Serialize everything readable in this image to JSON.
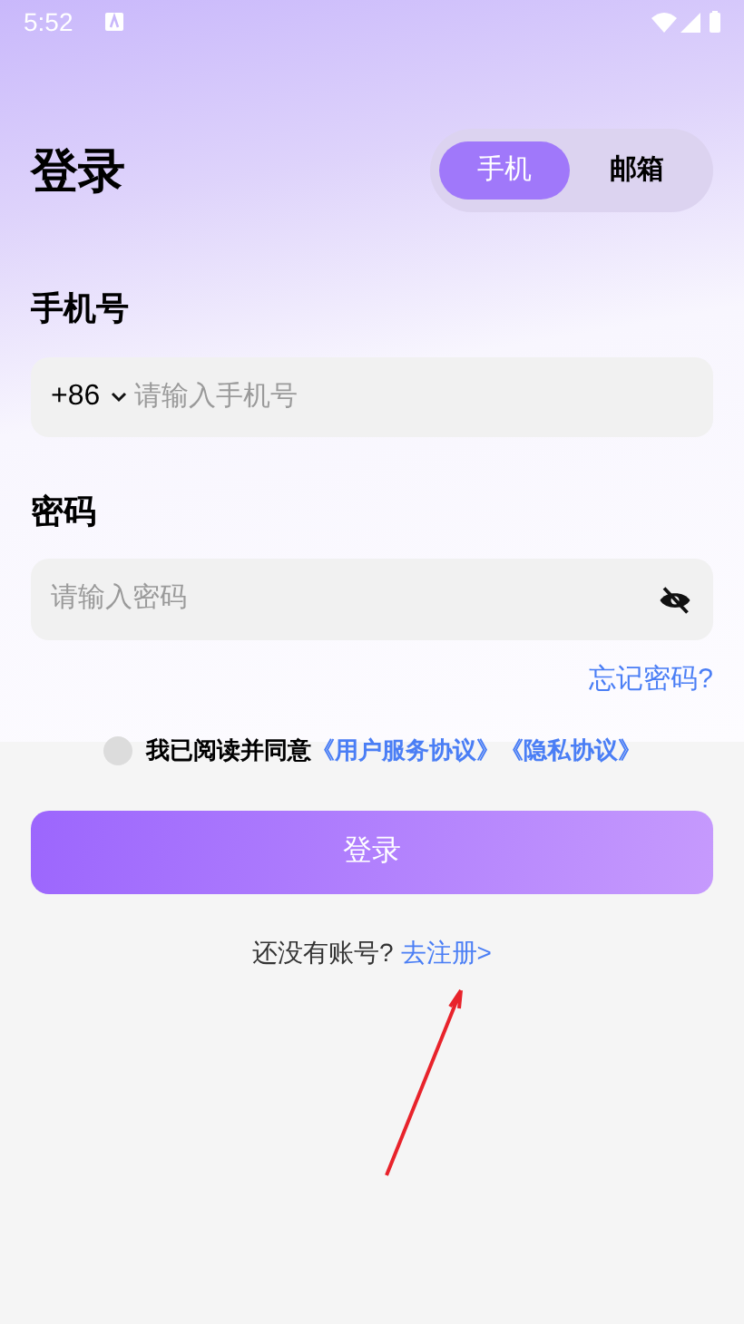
{
  "status_bar": {
    "time": "5:52"
  },
  "title": "登录",
  "tabs": [
    {
      "label": "手机",
      "selected": true
    },
    {
      "label": "邮箱",
      "selected": false
    }
  ],
  "phone": {
    "label": "手机号",
    "country_code": "+86",
    "placeholder": "请输入手机号"
  },
  "password": {
    "label": "密码",
    "placeholder": "请输入密码",
    "visible": false
  },
  "forgot_link": "忘记密码?",
  "agreement": {
    "checked": false,
    "text": "我已阅读并同意",
    "links": [
      "《用户服务协议》",
      "《隐私协议》"
    ]
  },
  "login_button": "登录",
  "register": {
    "prompt": "还没有账号?",
    "link": "去注册>"
  }
}
